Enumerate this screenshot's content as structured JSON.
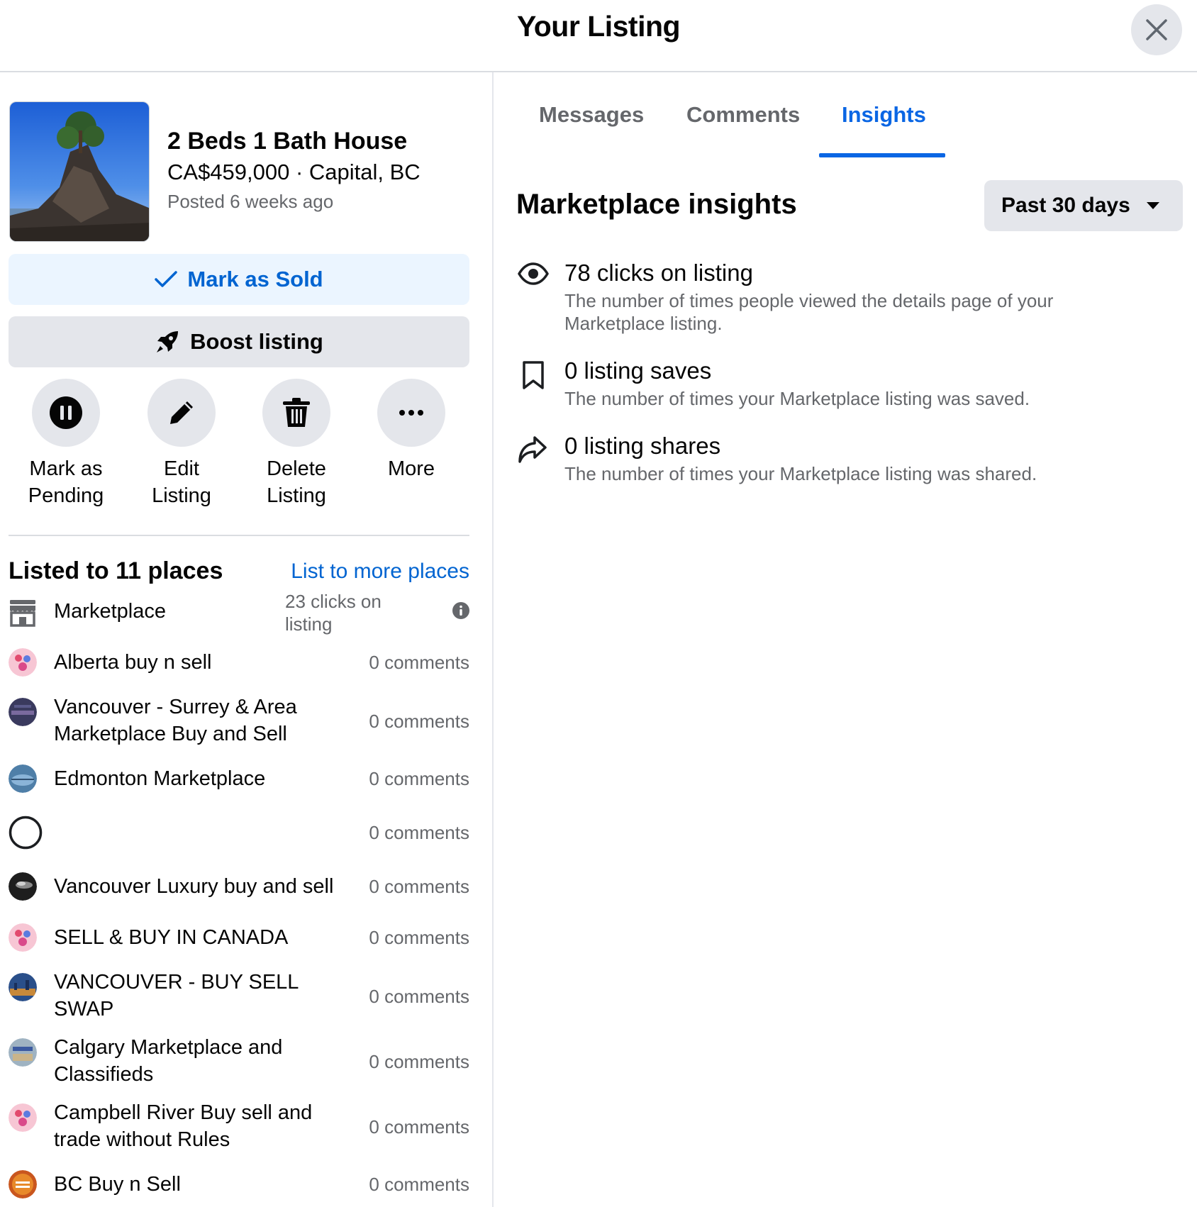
{
  "header": {
    "title": "Your Listing"
  },
  "listing": {
    "title": "2 Beds 1 Bath House",
    "price_location": "CA$459,000 · Capital, BC",
    "posted": "Posted 6 weeks ago"
  },
  "buttons": {
    "mark_sold": "Mark as Sold",
    "boost": "Boost listing"
  },
  "actions": [
    {
      "line1": "Mark as",
      "line2": "Pending",
      "icon": "pause-icon"
    },
    {
      "line1": "Edit",
      "line2": "Listing",
      "icon": "pencil-icon"
    },
    {
      "line1": "Delete",
      "line2": "Listing",
      "icon": "trash-icon"
    },
    {
      "line1": "More",
      "line2": "",
      "icon": "more-icon"
    }
  ],
  "places": {
    "title": "Listed to 11 places",
    "more_link": "List to more places",
    "marketplace": {
      "name": "Marketplace",
      "clicks_line1": "23 clicks on",
      "clicks_line2": "listing"
    },
    "groups": [
      {
        "line1": "Alberta buy n sell",
        "line2": "",
        "count": "0 comments"
      },
      {
        "line1": "Vancouver - Surrey & Area",
        "line2": "Marketplace Buy and Sell",
        "count": "0 comments"
      },
      {
        "line1": "Edmonton Marketplace",
        "line2": "",
        "count": "0 comments"
      },
      {
        "line1": "",
        "line2": "",
        "count": "0 comments"
      },
      {
        "line1": "Vancouver Luxury buy and sell",
        "line2": "",
        "count": "0 comments"
      },
      {
        "line1": "SELL & BUY IN CANADA",
        "line2": "",
        "count": "0 comments"
      },
      {
        "line1": "VANCOUVER - BUY SELL",
        "line2": "SWAP",
        "count": "0 comments"
      },
      {
        "line1": "Calgary Marketplace and",
        "line2": "Classifieds",
        "count": "0 comments"
      },
      {
        "line1": "Campbell River Buy sell and",
        "line2": "trade without Rules",
        "count": "0 comments"
      },
      {
        "line1": "BC Buy n Sell",
        "line2": "",
        "count": "0 comments"
      }
    ]
  },
  "tabs": [
    {
      "label": "Messages",
      "active": false
    },
    {
      "label": "Comments",
      "active": false
    },
    {
      "label": "Insights",
      "active": true
    }
  ],
  "insights": {
    "title": "Marketplace insights",
    "period": "Past 30 days",
    "metrics": [
      {
        "icon": "eye-icon",
        "title": "78 clicks on listing",
        "desc": "The number of times people viewed the details page of your Marketplace listing."
      },
      {
        "icon": "bookmark-icon",
        "title": "0 listing saves",
        "desc": "The number of times your Marketplace listing was saved."
      },
      {
        "icon": "share-icon",
        "title": "0 listing shares",
        "desc": "The number of times your Marketplace listing was shared."
      }
    ]
  },
  "colors": {
    "accent": "#0a66e4",
    "link": "#0064d1",
    "button_bg": "#e4e6eb",
    "secondary_text": "#65676b"
  }
}
